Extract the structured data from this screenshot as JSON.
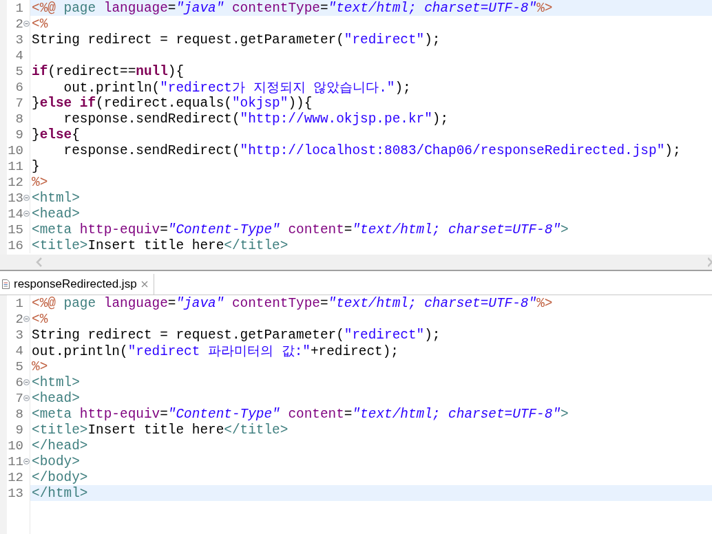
{
  "editors": [
    {
      "lines": [
        {
          "number": "1",
          "fold": false,
          "current": true,
          "tokens": [
            {
              "kind": "delim",
              "text": "<%@"
            },
            {
              "kind": "directive",
              "text": " page"
            },
            {
              "kind": "attr",
              "text": " language"
            },
            {
              "kind": "plain",
              "text": "="
            },
            {
              "kind": "value",
              "text": "\"java\""
            },
            {
              "kind": "attr",
              "text": " contentType"
            },
            {
              "kind": "plain",
              "text": "="
            },
            {
              "kind": "value",
              "text": "\"text/html; charset=UTF-8\""
            },
            {
              "kind": "delim",
              "text": "%>"
            }
          ]
        },
        {
          "number": "2",
          "fold": true,
          "current": false,
          "tokens": [
            {
              "kind": "delim",
              "text": "<%"
            }
          ]
        },
        {
          "number": "3",
          "fold": false,
          "current": false,
          "tokens": [
            {
              "kind": "plain",
              "text": "String redirect = request.getParameter("
            },
            {
              "kind": "string",
              "text": "\"redirect\""
            },
            {
              "kind": "plain",
              "text": ");"
            }
          ]
        },
        {
          "number": "4",
          "fold": false,
          "current": false
        },
        {
          "number": "5",
          "fold": false,
          "current": false,
          "tokens": [
            {
              "kind": "keyword",
              "text": "if"
            },
            {
              "kind": "plain",
              "text": "(redirect=="
            },
            {
              "kind": "keyword",
              "text": "null"
            },
            {
              "kind": "plain",
              "text": "){"
            }
          ]
        },
        {
          "number": "6",
          "fold": false,
          "current": false,
          "tokens": [
            {
              "kind": "plain",
              "text": "    out.println("
            },
            {
              "kind": "string",
              "text": "\"redirect가 지정되지 않았습니다.\""
            },
            {
              "kind": "plain",
              "text": ");"
            }
          ]
        },
        {
          "number": "7",
          "fold": false,
          "current": false,
          "tokens": [
            {
              "kind": "plain",
              "text": "}"
            },
            {
              "kind": "keyword",
              "text": "else if"
            },
            {
              "kind": "plain",
              "text": "(redirect.equals("
            },
            {
              "kind": "string",
              "text": "\"okjsp\""
            },
            {
              "kind": "plain",
              "text": ")){"
            }
          ]
        },
        {
          "number": "8",
          "fold": false,
          "current": false,
          "tokens": [
            {
              "kind": "plain",
              "text": "    response.sendRedirect("
            },
            {
              "kind": "string",
              "text": "\"http://www.okjsp.pe.kr\""
            },
            {
              "kind": "plain",
              "text": ");"
            }
          ]
        },
        {
          "number": "9",
          "fold": false,
          "current": false,
          "tokens": [
            {
              "kind": "plain",
              "text": "}"
            },
            {
              "kind": "keyword",
              "text": "else"
            },
            {
              "kind": "plain",
              "text": "{"
            }
          ]
        },
        {
          "number": "10",
          "fold": false,
          "current": false,
          "tokens": [
            {
              "kind": "plain",
              "text": "    response.sendRedirect("
            },
            {
              "kind": "string",
              "text": "\"http://localhost:8083/Chap06/responseRedirected.jsp\""
            },
            {
              "kind": "plain",
              "text": ");"
            }
          ]
        },
        {
          "number": "11",
          "fold": false,
          "current": false,
          "tokens": [
            {
              "kind": "plain",
              "text": "}"
            }
          ]
        },
        {
          "number": "12",
          "fold": false,
          "current": false,
          "tokens": [
            {
              "kind": "delim",
              "text": "%>"
            }
          ]
        },
        {
          "number": "13",
          "fold": true,
          "current": false,
          "tokens": [
            {
              "kind": "tag",
              "text": "<html>"
            }
          ]
        },
        {
          "number": "14",
          "fold": true,
          "current": false,
          "tokens": [
            {
              "kind": "tag",
              "text": "<head>"
            }
          ]
        },
        {
          "number": "15",
          "fold": false,
          "current": false,
          "tokens": [
            {
              "kind": "tag",
              "text": "<meta"
            },
            {
              "kind": "attr",
              "text": " http-equiv"
            },
            {
              "kind": "plain",
              "text": "="
            },
            {
              "kind": "value",
              "text": "\"Content-Type\""
            },
            {
              "kind": "attr",
              "text": " content"
            },
            {
              "kind": "plain",
              "text": "="
            },
            {
              "kind": "value",
              "text": "\"text/html; charset=UTF-8\""
            },
            {
              "kind": "tag",
              "text": ">"
            }
          ]
        },
        {
          "number": "16",
          "fold": false,
          "current": false,
          "tokens": [
            {
              "kind": "tag",
              "text": "<title>"
            },
            {
              "kind": "plain",
              "text": "Insert title here"
            },
            {
              "kind": "tag",
              "text": "</title>"
            }
          ]
        }
      ]
    },
    {
      "tab": {
        "label": "responseRedirected.jsp"
      },
      "lines": [
        {
          "number": "1",
          "fold": false,
          "current": false,
          "tokens": [
            {
              "kind": "delim",
              "text": "<%@"
            },
            {
              "kind": "directive",
              "text": " page"
            },
            {
              "kind": "attr",
              "text": " language"
            },
            {
              "kind": "plain",
              "text": "="
            },
            {
              "kind": "value",
              "text": "\"java\""
            },
            {
              "kind": "attr",
              "text": " contentType"
            },
            {
              "kind": "plain",
              "text": "="
            },
            {
              "kind": "value",
              "text": "\"text/html; charset=UTF-8\""
            },
            {
              "kind": "delim",
              "text": "%>"
            }
          ]
        },
        {
          "number": "2",
          "fold": true,
          "current": false,
          "tokens": [
            {
              "kind": "delim",
              "text": "<%"
            }
          ]
        },
        {
          "number": "3",
          "fold": false,
          "current": false,
          "tokens": [
            {
              "kind": "plain",
              "text": "String redirect = request.getParameter("
            },
            {
              "kind": "string",
              "text": "\"redirect\""
            },
            {
              "kind": "plain",
              "text": ");"
            }
          ]
        },
        {
          "number": "4",
          "fold": false,
          "current": false,
          "tokens": [
            {
              "kind": "plain",
              "text": "out.println("
            },
            {
              "kind": "string",
              "text": "\"redirect 파라미터의 값:\""
            },
            {
              "kind": "plain",
              "text": "+redirect);"
            }
          ]
        },
        {
          "number": "5",
          "fold": false,
          "current": false,
          "tokens": [
            {
              "kind": "delim",
              "text": "%>"
            }
          ]
        },
        {
          "number": "6",
          "fold": true,
          "current": false,
          "tokens": [
            {
              "kind": "tag",
              "text": "<html>"
            }
          ]
        },
        {
          "number": "7",
          "fold": true,
          "current": false,
          "tokens": [
            {
              "kind": "tag",
              "text": "<head>"
            }
          ]
        },
        {
          "number": "8",
          "fold": false,
          "current": false,
          "tokens": [
            {
              "kind": "tag",
              "text": "<meta"
            },
            {
              "kind": "attr",
              "text": " http-equiv"
            },
            {
              "kind": "plain",
              "text": "="
            },
            {
              "kind": "value",
              "text": "\"Content-Type\""
            },
            {
              "kind": "attr",
              "text": " content"
            },
            {
              "kind": "plain",
              "text": "="
            },
            {
              "kind": "value",
              "text": "\"text/html; charset=UTF-8\""
            },
            {
              "kind": "tag",
              "text": ">"
            }
          ]
        },
        {
          "number": "9",
          "fold": false,
          "current": false,
          "tokens": [
            {
              "kind": "tag",
              "text": "<title>"
            },
            {
              "kind": "plain",
              "text": "Insert title here"
            },
            {
              "kind": "tag",
              "text": "</title>"
            }
          ]
        },
        {
          "number": "10",
          "fold": false,
          "current": false,
          "tokens": [
            {
              "kind": "tag",
              "text": "</head>"
            }
          ]
        },
        {
          "number": "11",
          "fold": true,
          "current": false,
          "tokens": [
            {
              "kind": "tag",
              "text": "<body>"
            }
          ]
        },
        {
          "number": "12",
          "fold": false,
          "current": false,
          "tokens": [
            {
              "kind": "tag",
              "text": "</body>"
            }
          ]
        },
        {
          "number": "13",
          "fold": false,
          "current": true,
          "tokens": [
            {
              "kind": "tag",
              "text": "</html>"
            }
          ]
        }
      ]
    }
  ]
}
